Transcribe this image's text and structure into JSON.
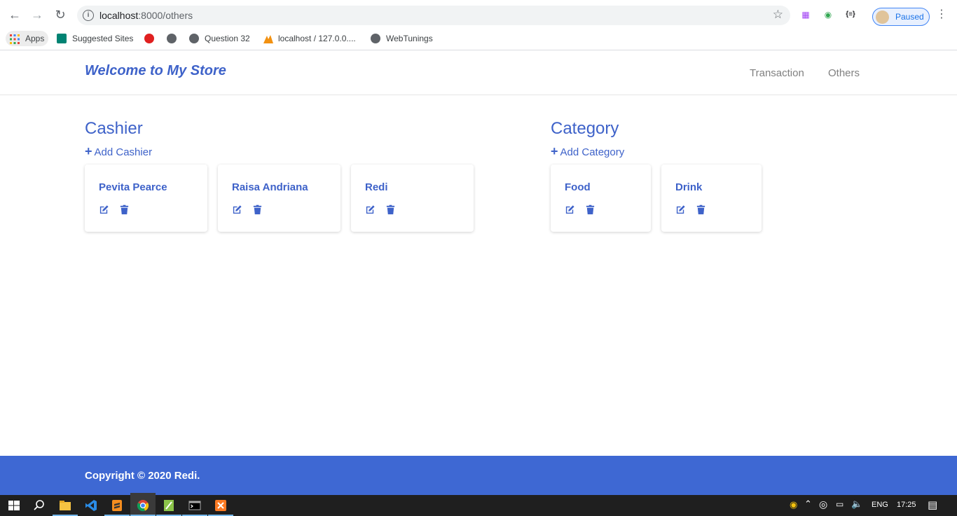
{
  "browser": {
    "url_host": "localhost",
    "url_path": ":8000/others",
    "profile_status": "Paused",
    "bookmarks": [
      "Apps",
      "Suggested Sites",
      "Question 32",
      "localhost / 127.0.0....",
      "WebTunings"
    ]
  },
  "navbar": {
    "brand": "Welcome to My Store",
    "links": [
      "Transaction",
      "Others"
    ]
  },
  "cashier": {
    "title": "Cashier",
    "add_label": "Add Cashier",
    "items": [
      "Pevita Pearce",
      "Raisa Andriana",
      "Redi"
    ]
  },
  "category": {
    "title": "Category",
    "add_label": "Add Category",
    "items": [
      "Food",
      "Drink"
    ]
  },
  "footer": {
    "copyright": "Copyright © 2020 Redi."
  },
  "taskbar": {
    "lang": "ENG",
    "time": "17:25"
  },
  "colors": {
    "accent": "#3e62c9",
    "footer_bg": "#3e68d3"
  },
  "icons": {
    "edit": "edit-icon",
    "delete": "trash-icon"
  }
}
